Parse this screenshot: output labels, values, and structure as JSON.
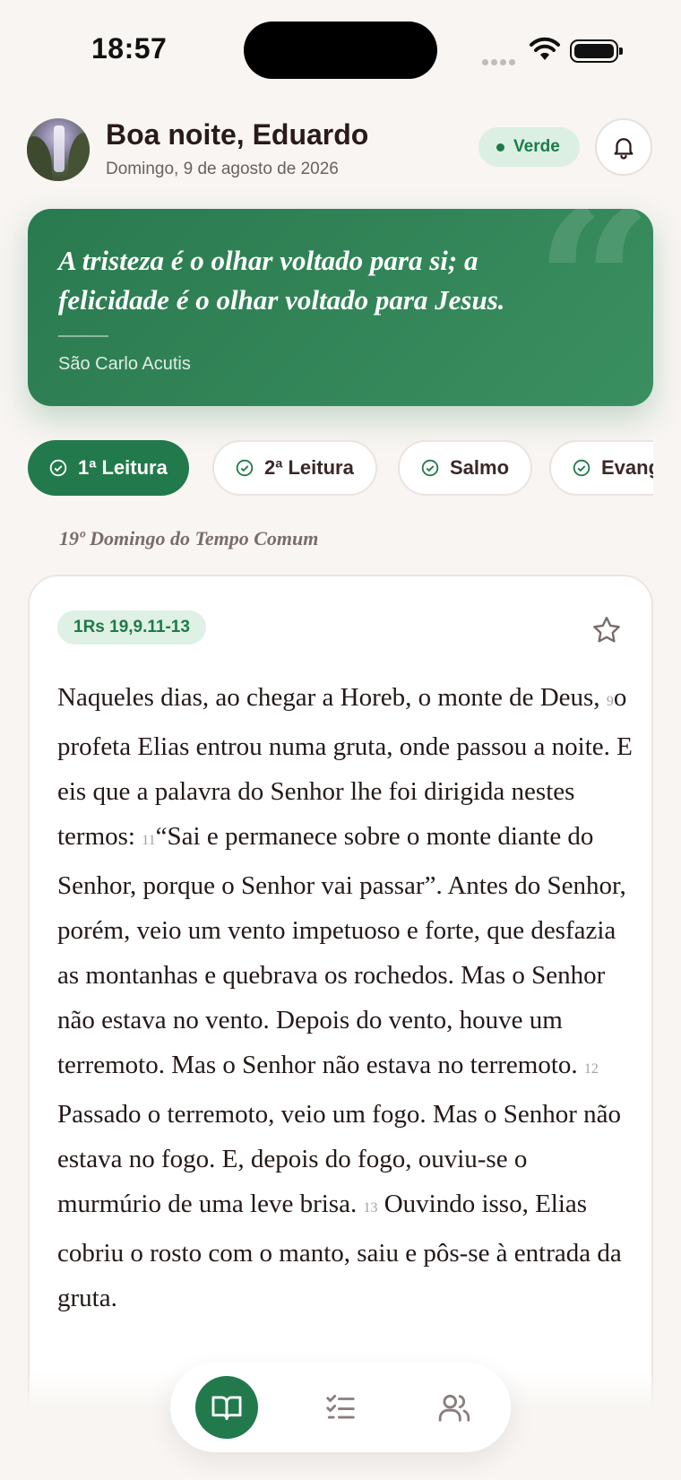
{
  "status_bar": {
    "time": "18:57"
  },
  "header": {
    "greeting": "Boa noite, Eduardo",
    "date": "Domingo, 9 de agosto de 2026",
    "season_badge": "Verde",
    "season_color": "#1e7a4a"
  },
  "quote": {
    "text": "A tristeza é o olhar voltado para si; a felicidade é o olhar voltado para Jesus.",
    "author": "São Carlo Acutis",
    "background": "#2a7a4f"
  },
  "tabs": [
    {
      "label": "1ª Leitura",
      "active": true,
      "icon": "check-circle-icon"
    },
    {
      "label": "2ª Leitura",
      "active": false,
      "icon": "check-circle-icon"
    },
    {
      "label": "Salmo",
      "active": false,
      "icon": "check-circle-icon"
    },
    {
      "label": "Evangelho",
      "active": false,
      "icon": "check-circle-icon"
    }
  ],
  "liturgical_day": "19º Domingo do Tempo Comum",
  "reading": {
    "reference": "1Rs 19,9.11-13",
    "segments": [
      {
        "text": "Naqueles dias, ao chegar a Horeb, o monte de Deus, "
      },
      {
        "verse": "9"
      },
      {
        "text": "o profeta Elias entrou numa gruta, onde passou a noite. E eis que a palavra do Senhor lhe foi dirigida nestes termos: "
      },
      {
        "verse": "11"
      },
      {
        "text": "“Sai e permanece sobre o monte diante do Senhor, porque o Senhor vai passar”. Antes do Senhor, porém, veio um vento impetuoso e forte, que desfazia as montanhas e quebrava os rochedos. Mas o Senhor não estava no vento. Depois do vento, houve um terremoto. Mas o Senhor não estava no terremoto. "
      },
      {
        "verse": "12"
      },
      {
        "text": " Passado o terremoto, veio um fogo. Mas o Senhor não estava no fogo. E, depois do fogo, ouviu-se o murmúrio de uma leve brisa. "
      },
      {
        "verse": "13"
      },
      {
        "text": " Ouvindo isso, Elias cobriu o rosto com o manto, saiu e pôs-se à entrada da gruta."
      }
    ]
  },
  "bottom_nav": [
    {
      "name": "readings",
      "icon": "open-book-icon",
      "active": true
    },
    {
      "name": "checklist",
      "icon": "checklist-icon",
      "active": false
    },
    {
      "name": "community",
      "icon": "users-icon",
      "active": false
    }
  ],
  "accent_color": "#227a4c"
}
